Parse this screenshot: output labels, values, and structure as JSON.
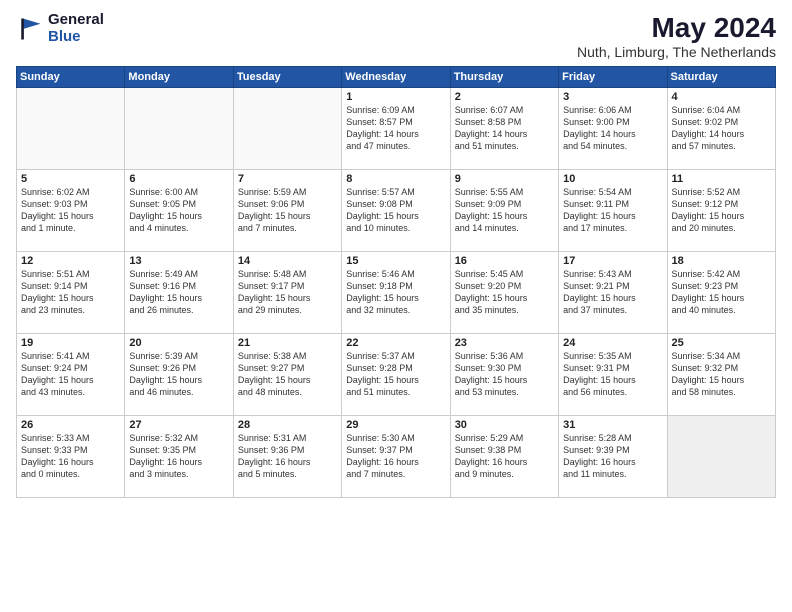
{
  "logo": {
    "general": "General",
    "blue": "Blue"
  },
  "title": {
    "month_year": "May 2024",
    "location": "Nuth, Limburg, The Netherlands"
  },
  "weekdays": [
    "Sunday",
    "Monday",
    "Tuesday",
    "Wednesday",
    "Thursday",
    "Friday",
    "Saturday"
  ],
  "weeks": [
    [
      {
        "day": "",
        "info": ""
      },
      {
        "day": "",
        "info": ""
      },
      {
        "day": "",
        "info": ""
      },
      {
        "day": "1",
        "info": "Sunrise: 6:09 AM\nSunset: 8:57 PM\nDaylight: 14 hours\nand 47 minutes."
      },
      {
        "day": "2",
        "info": "Sunrise: 6:07 AM\nSunset: 8:58 PM\nDaylight: 14 hours\nand 51 minutes."
      },
      {
        "day": "3",
        "info": "Sunrise: 6:06 AM\nSunset: 9:00 PM\nDaylight: 14 hours\nand 54 minutes."
      },
      {
        "day": "4",
        "info": "Sunrise: 6:04 AM\nSunset: 9:02 PM\nDaylight: 14 hours\nand 57 minutes."
      }
    ],
    [
      {
        "day": "5",
        "info": "Sunrise: 6:02 AM\nSunset: 9:03 PM\nDaylight: 15 hours\nand 1 minute."
      },
      {
        "day": "6",
        "info": "Sunrise: 6:00 AM\nSunset: 9:05 PM\nDaylight: 15 hours\nand 4 minutes."
      },
      {
        "day": "7",
        "info": "Sunrise: 5:59 AM\nSunset: 9:06 PM\nDaylight: 15 hours\nand 7 minutes."
      },
      {
        "day": "8",
        "info": "Sunrise: 5:57 AM\nSunset: 9:08 PM\nDaylight: 15 hours\nand 10 minutes."
      },
      {
        "day": "9",
        "info": "Sunrise: 5:55 AM\nSunset: 9:09 PM\nDaylight: 15 hours\nand 14 minutes."
      },
      {
        "day": "10",
        "info": "Sunrise: 5:54 AM\nSunset: 9:11 PM\nDaylight: 15 hours\nand 17 minutes."
      },
      {
        "day": "11",
        "info": "Sunrise: 5:52 AM\nSunset: 9:12 PM\nDaylight: 15 hours\nand 20 minutes."
      }
    ],
    [
      {
        "day": "12",
        "info": "Sunrise: 5:51 AM\nSunset: 9:14 PM\nDaylight: 15 hours\nand 23 minutes."
      },
      {
        "day": "13",
        "info": "Sunrise: 5:49 AM\nSunset: 9:16 PM\nDaylight: 15 hours\nand 26 minutes."
      },
      {
        "day": "14",
        "info": "Sunrise: 5:48 AM\nSunset: 9:17 PM\nDaylight: 15 hours\nand 29 minutes."
      },
      {
        "day": "15",
        "info": "Sunrise: 5:46 AM\nSunset: 9:18 PM\nDaylight: 15 hours\nand 32 minutes."
      },
      {
        "day": "16",
        "info": "Sunrise: 5:45 AM\nSunset: 9:20 PM\nDaylight: 15 hours\nand 35 minutes."
      },
      {
        "day": "17",
        "info": "Sunrise: 5:43 AM\nSunset: 9:21 PM\nDaylight: 15 hours\nand 37 minutes."
      },
      {
        "day": "18",
        "info": "Sunrise: 5:42 AM\nSunset: 9:23 PM\nDaylight: 15 hours\nand 40 minutes."
      }
    ],
    [
      {
        "day": "19",
        "info": "Sunrise: 5:41 AM\nSunset: 9:24 PM\nDaylight: 15 hours\nand 43 minutes."
      },
      {
        "day": "20",
        "info": "Sunrise: 5:39 AM\nSunset: 9:26 PM\nDaylight: 15 hours\nand 46 minutes."
      },
      {
        "day": "21",
        "info": "Sunrise: 5:38 AM\nSunset: 9:27 PM\nDaylight: 15 hours\nand 48 minutes."
      },
      {
        "day": "22",
        "info": "Sunrise: 5:37 AM\nSunset: 9:28 PM\nDaylight: 15 hours\nand 51 minutes."
      },
      {
        "day": "23",
        "info": "Sunrise: 5:36 AM\nSunset: 9:30 PM\nDaylight: 15 hours\nand 53 minutes."
      },
      {
        "day": "24",
        "info": "Sunrise: 5:35 AM\nSunset: 9:31 PM\nDaylight: 15 hours\nand 56 minutes."
      },
      {
        "day": "25",
        "info": "Sunrise: 5:34 AM\nSunset: 9:32 PM\nDaylight: 15 hours\nand 58 minutes."
      }
    ],
    [
      {
        "day": "26",
        "info": "Sunrise: 5:33 AM\nSunset: 9:33 PM\nDaylight: 16 hours\nand 0 minutes."
      },
      {
        "day": "27",
        "info": "Sunrise: 5:32 AM\nSunset: 9:35 PM\nDaylight: 16 hours\nand 3 minutes."
      },
      {
        "day": "28",
        "info": "Sunrise: 5:31 AM\nSunset: 9:36 PM\nDaylight: 16 hours\nand 5 minutes."
      },
      {
        "day": "29",
        "info": "Sunrise: 5:30 AM\nSunset: 9:37 PM\nDaylight: 16 hours\nand 7 minutes."
      },
      {
        "day": "30",
        "info": "Sunrise: 5:29 AM\nSunset: 9:38 PM\nDaylight: 16 hours\nand 9 minutes."
      },
      {
        "day": "31",
        "info": "Sunrise: 5:28 AM\nSunset: 9:39 PM\nDaylight: 16 hours\nand 11 minutes."
      },
      {
        "day": "",
        "info": ""
      }
    ]
  ]
}
